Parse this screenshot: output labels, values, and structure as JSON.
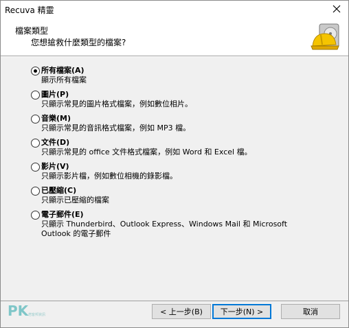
{
  "window": {
    "title": "Recuva 精靈"
  },
  "header": {
    "title": "檔案類型",
    "subtitle": "您想搶救什麼類型的檔案?"
  },
  "options": [
    {
      "label": "所有檔案(A)",
      "desc": "顯示所有檔案",
      "checked": true
    },
    {
      "label": "圖片(P)",
      "desc": "只顯示常見的圖片格式檔案，例如數位相片。",
      "checked": false
    },
    {
      "label": "音樂(M)",
      "desc": "只顯示常見的音訊格式檔案，例如 MP3 檔。",
      "checked": false
    },
    {
      "label": "文件(D)",
      "desc": "只顯示常見的 office 文件格式檔案，例如 Word 和 Excel 檔。",
      "checked": false
    },
    {
      "label": "影片(V)",
      "desc": "只顯示影片檔，例如數位相機的錄影檔。",
      "checked": false
    },
    {
      "label": "已壓縮(C)",
      "desc": "只顯示已壓縮的檔案",
      "checked": false
    },
    {
      "label": "電子郵件(E)",
      "desc": "只顯示 Thunderbird、Outlook Express、Windows Mail 和 Microsoft Outlook 的電子郵件",
      "checked": false
    }
  ],
  "buttons": {
    "back": "< 上一步(B)",
    "next": "下一步(N) >",
    "cancel": "取消"
  },
  "watermark": {
    "text": "PK",
    "small": "痞客邦資訊"
  },
  "colors": {
    "accent": "#0078d7",
    "body_bg": "#f0f0f0"
  }
}
